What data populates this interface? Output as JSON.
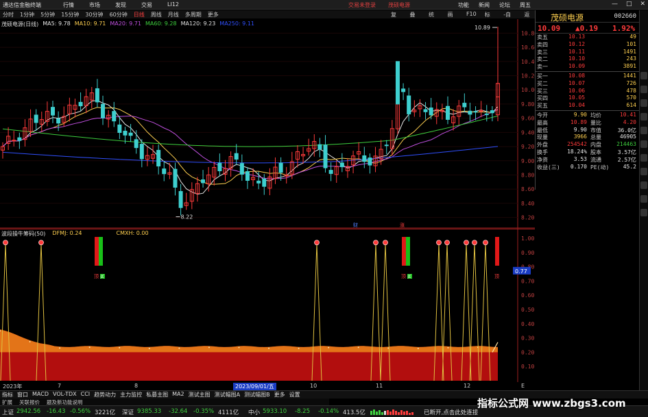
{
  "titlebar": {
    "app": "通达信金融终端",
    "menu": [
      "行情",
      "市场",
      "发现",
      "交易",
      "LI12"
    ],
    "promo": [
      "交易未登录",
      "茂硕电源"
    ],
    "tools": [
      "功能",
      "新闻",
      "论坛",
      "周五"
    ],
    "winctl": [
      "—",
      "□",
      "✕"
    ]
  },
  "toolbar": {
    "periods": [
      "分时",
      "1分钟",
      "5分钟",
      "15分钟",
      "30分钟",
      "60分钟",
      "日线",
      "周线",
      "月线",
      "多周期",
      "更多"
    ],
    "active": "日线",
    "tools": [
      "复权",
      "叠加",
      "统计",
      "画线",
      "F10",
      "标记",
      "-自选",
      "返回"
    ]
  },
  "legend": {
    "title": "茂硕电源(日线)",
    "ma": [
      {
        "label": "MA5: 9.78",
        "color": "#e8e8e8"
      },
      {
        "label": "MA10: 9.71",
        "color": "#ffd050"
      },
      {
        "label": "MA20: 9.71",
        "color": "#c050e0"
      },
      {
        "label": "MA60: 9.28",
        "color": "#3ecf3e"
      },
      {
        "label": "MA120: 9.23",
        "color": "#e0e0e0"
      },
      {
        "label": "MA250: 9.11",
        "color": "#3050ff"
      }
    ]
  },
  "indicator": {
    "title": "波段操牛筹码(50)",
    "dfmj": "DFMJ: 0.24",
    "cmxh": "CMXH: 0.00",
    "marker": "顶",
    "buy_marker": "买",
    "current_value": "0.77"
  },
  "quote": {
    "name": "茂硕电源",
    "code": "002660",
    "price": "10.09",
    "change": "▲0.19",
    "pct": "1.92%",
    "sells": [
      {
        "label": "卖五",
        "price": "10.13",
        "vol": "49"
      },
      {
        "label": "卖四",
        "price": "10.12",
        "vol": "101"
      },
      {
        "label": "卖三",
        "price": "10.11",
        "vol": "1491"
      },
      {
        "label": "卖二",
        "price": "10.10",
        "vol": "243"
      },
      {
        "label": "卖一",
        "price": "10.09",
        "vol": "3891"
      }
    ],
    "buys": [
      {
        "label": "买一",
        "price": "10.08",
        "vol": "1441"
      },
      {
        "label": "买二",
        "price": "10.07",
        "vol": "726"
      },
      {
        "label": "买三",
        "price": "10.06",
        "vol": "478"
      },
      {
        "label": "买四",
        "price": "10.05",
        "vol": "570"
      },
      {
        "label": "买五",
        "price": "10.04",
        "vol": "614"
      }
    ],
    "stats": [
      {
        "l1": "今开",
        "v1": "9.90",
        "l2": "均价",
        "v2": "10.41",
        "c1": "#ffd050",
        "c2": "#ff3b3b"
      },
      {
        "l1": "最高",
        "v1": "10.89",
        "l2": "量比",
        "v2": "4.20",
        "c1": "#ff3b3b",
        "c2": "#ff3b3b"
      },
      {
        "l1": "最低",
        "v1": "9.90",
        "l2": "市值",
        "v2": "36.0亿",
        "c1": "#e8e8e8",
        "c2": "#e8e8e8"
      },
      {
        "l1": "现量",
        "v1": "3966",
        "l2": "总量",
        "v2": "46905",
        "c1": "#ffd050",
        "c2": "#e8e8e8"
      },
      {
        "l1": "外盘",
        "v1": "254542",
        "l2": "内盘",
        "v2": "214463",
        "c1": "#ff3b3b",
        "c2": "#3ecf3e"
      },
      {
        "l1": "换手",
        "v1": "18.24%",
        "l2": "股本",
        "v2": "3.57亿",
        "c1": "#e8e8e8",
        "c2": "#e8e8e8"
      },
      {
        "l1": "净资",
        "v1": "3.53",
        "l2": "流通",
        "v2": "2.57亿",
        "c1": "#e8e8e8",
        "c2": "#e8e8e8"
      },
      {
        "l1": "收益(三)",
        "v1": "0.170",
        "l2": "PE(动)",
        "v2": "45.2",
        "c1": "#e8e8e8",
        "c2": "#e8e8e8"
      }
    ]
  },
  "price_axis": [
    "10.80",
    "10.60",
    "10.40",
    "10.20",
    "10.00",
    "9.80",
    "9.60",
    "9.40",
    "9.20",
    "9.00",
    "8.80",
    "8.60",
    "8.40",
    "8.20"
  ],
  "ind_axis": [
    "1.00",
    "0.90",
    "0.80",
    "0.70",
    "0.60",
    "0.50",
    "0.40",
    "0.30",
    "0.20",
    "0.10"
  ],
  "annotations": {
    "high": "10.89",
    "low": "8.22",
    "cai": "财",
    "zhang": "涨"
  },
  "dates": [
    {
      "t": "2023年"
    },
    {
      "t": "7"
    },
    {
      "t": "8"
    },
    {
      "t": "2023/09/01/五",
      "hl": true
    },
    {
      "t": "10"
    },
    {
      "t": "11"
    },
    {
      "t": "12"
    },
    {
      "t": "E"
    }
  ],
  "tabs": [
    "指标",
    "窗口",
    "MACD",
    "VOL-TDX",
    "CCI",
    "趋势动力",
    "主力监控",
    "私募主图",
    "MA2",
    "测试主图",
    "测试幅图A",
    "测试幅图B",
    "更多",
    "设置"
  ],
  "tabs2": [
    "扩展",
    "关联报价",
    "题及新功能说明"
  ],
  "status": {
    "sh_label": "上证",
    "sh": "2942.56",
    "sh_chg": "-16.43",
    "sh_pct": "-0.56%",
    "sh_amt": "3221亿",
    "sz_label": "深证",
    "sz": "9385.33",
    "sz_chg": "-32.64",
    "sz_pct": "-0.35%",
    "sz_amt": "4111亿",
    "zx_label": "中小",
    "zx": "5933.10",
    "zx_chg": "-8.25",
    "zx_pct": "-0.14%",
    "zx_amt": "413.5亿",
    "net": "已断开,点击此处连接"
  },
  "watermark": "指标公式网 www.zbgs3.com",
  "colors": {
    "up": "#ff3b3b",
    "down": "#3ecfcf",
    "ma5": "#e8e8e8",
    "ma10": "#ffd050",
    "ma20": "#c050e0",
    "ma60": "#3ecf3e",
    "ma250": "#3050ff"
  }
}
